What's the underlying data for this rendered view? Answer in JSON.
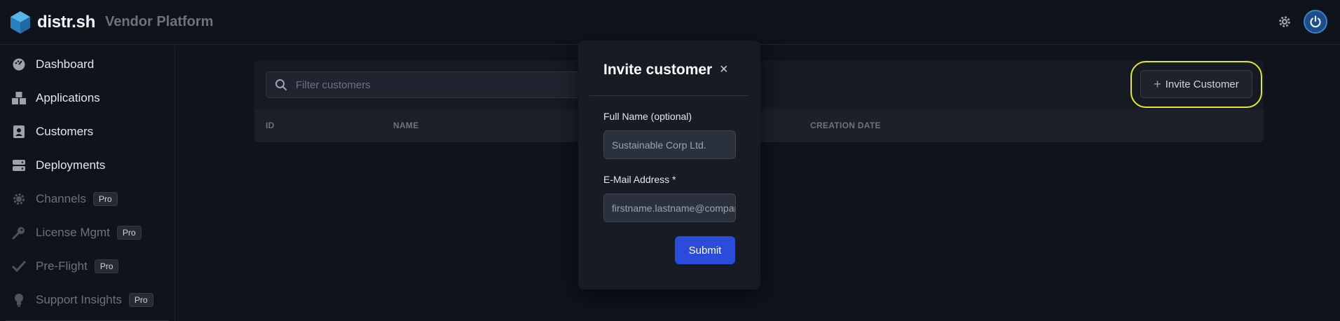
{
  "header": {
    "brand": "distr.sh",
    "subtitle": "Vendor Platform",
    "icons": {
      "logo": "cube-logo",
      "settings": "gear-icon",
      "avatar": "power-avatar-icon"
    }
  },
  "sidebar": {
    "items": [
      {
        "label": "Dashboard",
        "icon": "dashboard-icon",
        "pro": ""
      },
      {
        "label": "Applications",
        "icon": "applications-icon",
        "pro": ""
      },
      {
        "label": "Customers",
        "icon": "customers-icon",
        "pro": ""
      },
      {
        "label": "Deployments",
        "icon": "deployments-icon",
        "pro": ""
      },
      {
        "label": "Channels",
        "icon": "channels-gear-icon",
        "pro": "Pro"
      },
      {
        "label": "License Mgmt",
        "icon": "key-icon",
        "pro": "Pro"
      },
      {
        "label": "Pre-Flight",
        "icon": "check-icon",
        "pro": "Pro"
      },
      {
        "label": "Support Insights",
        "icon": "lightbulb-icon",
        "pro": "Pro"
      }
    ]
  },
  "main": {
    "search_placeholder": "Filter customers",
    "invite_button": "Invite Customer",
    "columns": [
      "ID",
      "NAME",
      "CREATION DATE"
    ]
  },
  "modal": {
    "title": "Invite customer",
    "close": "×",
    "name_label": "Full Name (optional)",
    "name_placeholder": "Sustainable Corp Ltd.",
    "email_label": "E-Mail Address *",
    "email_placeholder": "firstname.lastname@company.com",
    "submit": "Submit"
  },
  "colors": {
    "background": "#0f131b",
    "accent": "#2b4bdb",
    "highlight": "#e6e62a",
    "logo": "#3b9bd8"
  }
}
